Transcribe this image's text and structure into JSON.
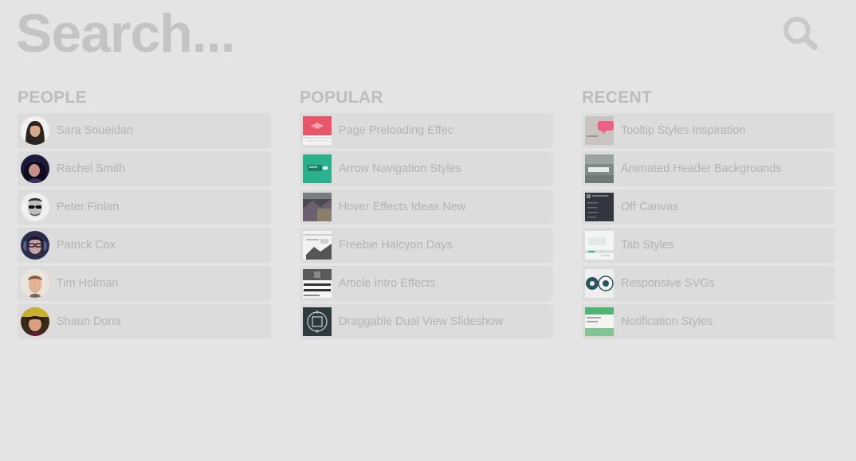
{
  "search": {
    "placeholder": "Search...",
    "icon": "search-icon"
  },
  "columns": [
    {
      "title": "PEOPLE",
      "items": [
        {
          "label": "Sara Soueidan",
          "icon": "avatar"
        },
        {
          "label": "Rachel Smith",
          "icon": "avatar"
        },
        {
          "label": "Peter Finlan",
          "icon": "avatar"
        },
        {
          "label": "Patrick Cox",
          "icon": "avatar"
        },
        {
          "label": "Tim Holman",
          "icon": "avatar"
        },
        {
          "label": "Shaun Dona",
          "icon": "avatar"
        }
      ]
    },
    {
      "title": "POPULAR",
      "items": [
        {
          "label": "Page Preloading Effec",
          "icon": "thumbnail"
        },
        {
          "label": "Arrow Navigation Styles",
          "icon": "thumbnail"
        },
        {
          "label": "Hover Effects Ideas New",
          "icon": "thumbnail"
        },
        {
          "label": "Freebie Halcyon Days",
          "icon": "thumbnail"
        },
        {
          "label": "Article Intro Effects",
          "icon": "thumbnail"
        },
        {
          "label": "Draggable Dual View Slideshow",
          "icon": "thumbnail"
        }
      ]
    },
    {
      "title": "RECENT",
      "items": [
        {
          "label": "Tooltip Styles Inspiration",
          "icon": "thumbnail"
        },
        {
          "label": "Animated Header Backgrounds",
          "icon": "thumbnail"
        },
        {
          "label": "Off Canvas",
          "icon": "thumbnail"
        },
        {
          "label": "Tab Styles",
          "icon": "thumbnail"
        },
        {
          "label": "Responsive SVGs",
          "icon": "thumbnail"
        },
        {
          "label": "Notification Styles",
          "icon": "thumbnail"
        }
      ]
    }
  ],
  "colors": {
    "background": "#e4e4e4",
    "item_background": "#dcdcdc",
    "text": "#b3b3b3",
    "heading": "#bdbdbd"
  }
}
